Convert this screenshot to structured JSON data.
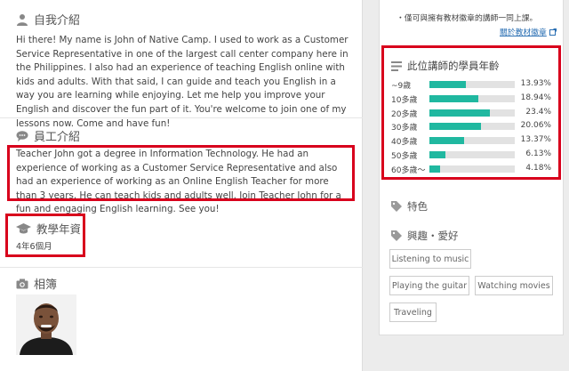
{
  "sections": {
    "intro": {
      "title": "自我介紹",
      "text": "Hi there! My name is John of Native Camp. I used to work as a Customer Service Representative in one of the largest call center company here in the Philippines. I also had an experience of teaching English online with kids and adults. With that said, I can guide and teach you English in a way you are learning while enjoying. Let me help you improve your English and discover the fun part of it. You're welcome to join one of my lessons now. Come and have fun!"
    },
    "staff": {
      "title": "員工介紹",
      "text": "Teacher John got a degree in Information Technology. He had an experience of working as a Customer Service Representative and also had an experience of working as an Online English Teacher for more than 3 years. He can teach kids and adults well. Join Teacher John for a fun and engaging English learning. See you!"
    },
    "experience": {
      "title": "教學年資",
      "value": "4年6個月"
    },
    "album": {
      "title": "相簿"
    }
  },
  "sidebar": {
    "note": "・僅可與擁有教材徽章的講師一同上課。",
    "link": "關於教材徽章",
    "age_stats": {
      "title": "此位講師的學員年齡",
      "rows": [
        {
          "label": "~9歲",
          "pct": "13.93%",
          "value": 13.93
        },
        {
          "label": "10多歲",
          "pct": "18.94%",
          "value": 18.94
        },
        {
          "label": "20多歲",
          "pct": "23.4%",
          "value": 23.4
        },
        {
          "label": "30多歲",
          "pct": "20.06%",
          "value": 20.06
        },
        {
          "label": "40多歲",
          "pct": "13.37%",
          "value": 13.37
        },
        {
          "label": "50多歲",
          "pct": "6.13%",
          "value": 6.13
        },
        {
          "label": "60多歲～",
          "pct": "4.18%",
          "value": 4.18
        }
      ]
    },
    "features": {
      "title": "特色"
    },
    "hobbies": {
      "title": "興趣・愛好",
      "items": [
        "Listening to music",
        "Playing the guitar",
        "Watching movies",
        "Traveling"
      ]
    }
  },
  "colors": {
    "accent": "#20b8a0",
    "highlight": "#d8001c",
    "link": "#2a6fb3"
  }
}
